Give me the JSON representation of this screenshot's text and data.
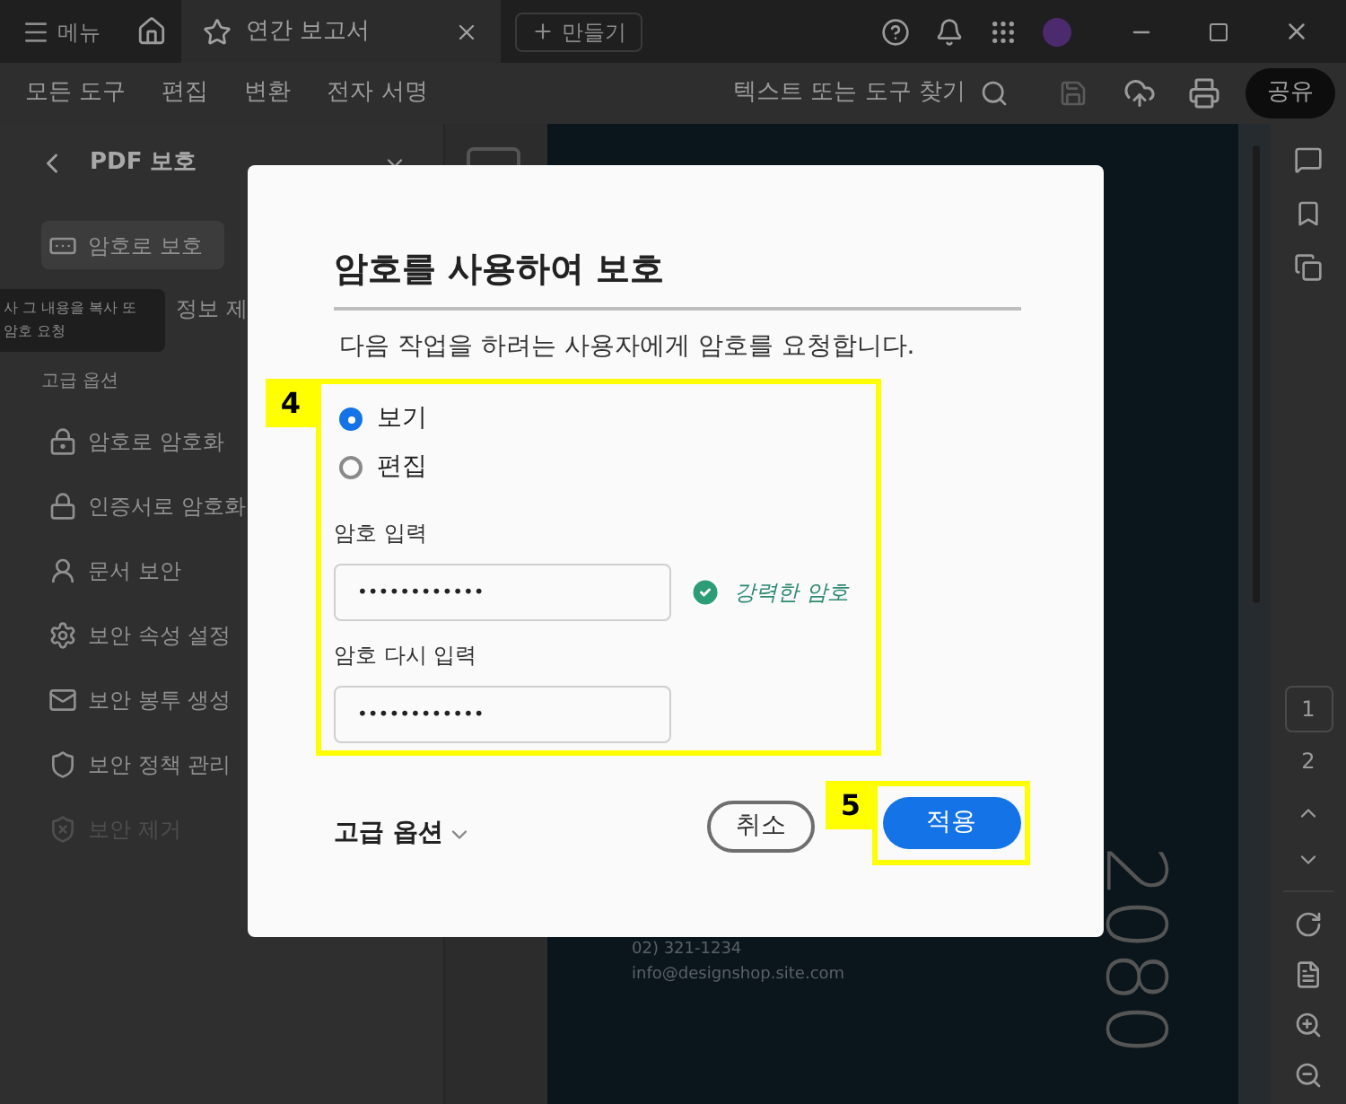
{
  "title_bar": {
    "menu": "메뉴",
    "tab": {
      "title": "연간 보고서"
    },
    "new_button": "만들기"
  },
  "toolbar": {
    "menus": [
      "모든 도구",
      "편집",
      "변환",
      "전자 서명"
    ],
    "search": {
      "placeholder": "텍스트 또는 도구 찾기"
    },
    "share": "공유"
  },
  "sidebar": {
    "title": "PDF 보호",
    "items": [
      {
        "label": "암호로 보호",
        "selected": true,
        "disabled": false
      },
      {
        "label": "정보 제",
        "selected": false,
        "disabled": false
      }
    ],
    "tooltip": [
      "사 그 내용을 복사 또",
      "암호 요청"
    ],
    "section": "고급 옵션",
    "advanced": [
      {
        "label": "암호로 암호화",
        "disabled": false
      },
      {
        "label": "인증서로 암호화",
        "disabled": false
      },
      {
        "label": "문서 보안",
        "disabled": false
      },
      {
        "label": "보안 속성 설정",
        "disabled": false
      },
      {
        "label": "보안 봉투 생성",
        "disabled": false
      },
      {
        "label": "보안 정책 관리",
        "disabled": false
      },
      {
        "label": "보안 제거",
        "disabled": true
      }
    ]
  },
  "document": {
    "year": "2080",
    "phone": "02) 321-1234",
    "email": "info@designshop.site.com"
  },
  "page_nav": {
    "pages": [
      {
        "label": "1",
        "selected": true
      },
      {
        "label": "2",
        "selected": false
      }
    ]
  },
  "dialog": {
    "title": "암호를 사용하여 보호",
    "description": "다음 작업을 하려는 사용자에게 암호를 요청합니다.",
    "permissions": [
      {
        "label": "보기",
        "selected": true
      },
      {
        "label": "편집",
        "selected": false
      }
    ],
    "password": {
      "label": "암호 입력",
      "value": "••••••••••••"
    },
    "strength": "강력한 암호",
    "confirm": {
      "label": "암호 다시 입력",
      "value": "••••••••••••"
    },
    "advanced": "고급 옵션",
    "cancel": "취소",
    "apply": "적용"
  },
  "callouts": [
    "4",
    "5"
  ]
}
